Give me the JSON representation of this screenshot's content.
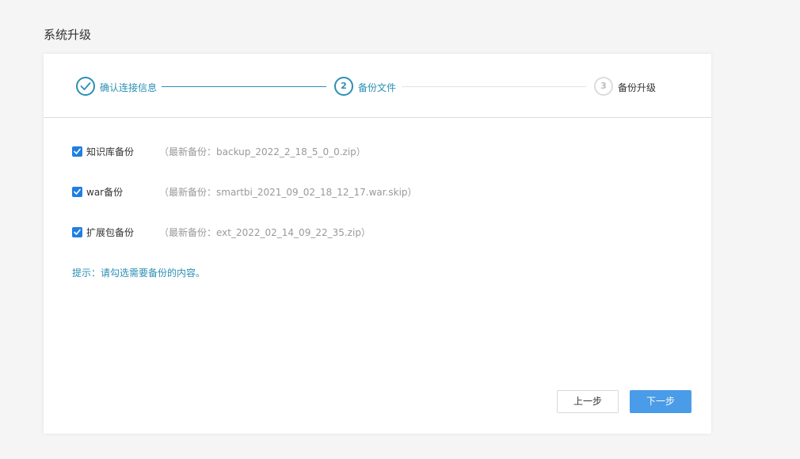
{
  "page": {
    "title": "系统升级"
  },
  "steps": [
    {
      "number": "1",
      "label": "确认连接信息",
      "status": "done"
    },
    {
      "number": "2",
      "label": "备份文件",
      "status": "active"
    },
    {
      "number": "3",
      "label": "备份升级",
      "status": "pending"
    }
  ],
  "options": [
    {
      "label": "知识库备份",
      "hint": "（最新备份：backup_2022_2_18_5_0_0.zip）",
      "checked": true
    },
    {
      "label": "war备份",
      "hint": "（最新备份：smartbi_2021_09_02_18_12_17.war.skip）",
      "checked": true
    },
    {
      "label": "扩展包备份",
      "hint": "（最新备份：ext_2022_02_14_09_22_35.zip）",
      "checked": true
    }
  ],
  "tip": "提示：请勾选需要备份的内容。",
  "buttons": {
    "prev": "上一步",
    "next": "下一步"
  },
  "colors": {
    "accent": "#2a8fb3",
    "primary_button": "#4a9be8",
    "checkbox": "#1f7fe0"
  },
  "icons": {
    "done_step": "check-icon",
    "checkbox": "checkmark-icon"
  }
}
